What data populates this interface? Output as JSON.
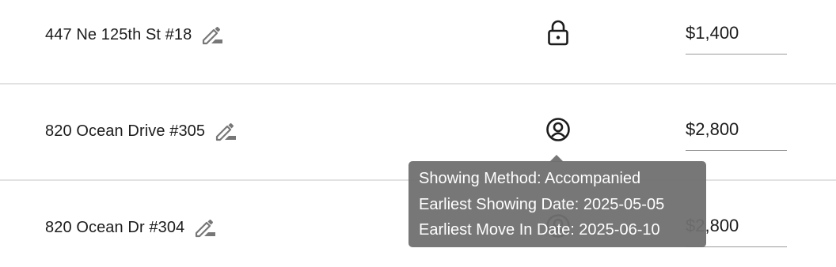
{
  "listings": [
    {
      "address": "447 Ne 125th St #18",
      "status_icon": "lock-icon",
      "price": "$1,400"
    },
    {
      "address": "820 Ocean Drive #305",
      "status_icon": "user-circle-icon",
      "price": "$2,800"
    },
    {
      "address": "820 Ocean Dr #304",
      "status_icon": "user-circle-icon",
      "price": "$2,800"
    }
  ],
  "tooltip": {
    "line1": "Showing Method: Accompanied",
    "line2": "Earliest Showing Date: 2025-05-05",
    "line3": "Earliest Move In Date: 2025-06-10"
  },
  "colors": {
    "text": "#1c1c1c",
    "icon_gray": "#777777",
    "divider": "#e2e2e2",
    "tooltip_bg": "#707070"
  }
}
